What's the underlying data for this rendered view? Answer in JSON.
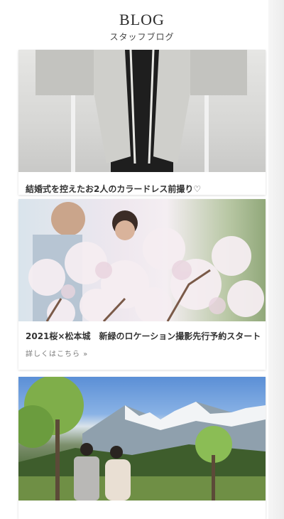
{
  "header": {
    "title": "BLOG",
    "subtitle": "スタッフブログ"
  },
  "posts": [
    {
      "caption": "結婚式を控えたお2人のカラードレス前撮り♡",
      "image": "groom-kimono-photo"
    },
    {
      "caption": "2021桜×松本城　新緑のロケーション撮影先行予約スタート",
      "more_label": "詳しくはこちら »",
      "image": "cherry-blossom-couple-photo"
    },
    {
      "caption": "",
      "image": "mountain-couple-photo"
    }
  ],
  "colors": {
    "text": "#333333",
    "background": "#ffffff"
  }
}
